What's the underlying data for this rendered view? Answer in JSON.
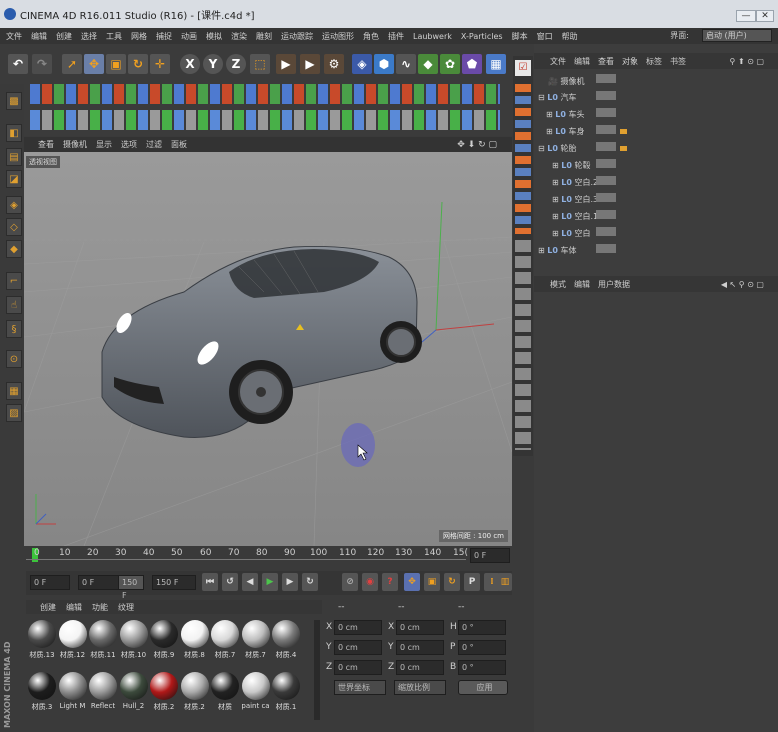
{
  "window": {
    "title": "CINEMA 4D R16.011 Studio (R16) - [课件.c4d *]",
    "minimize": "—",
    "maximize": "□",
    "close": "✕"
  },
  "menu": [
    "文件",
    "编辑",
    "创建",
    "选择",
    "工具",
    "网格",
    "捕捉",
    "动画",
    "模拟",
    "渲染",
    "雕刻",
    "运动跟踪",
    "运动图形",
    "角色",
    "插件",
    "Laubwerk",
    "X-Particles",
    "脚本",
    "窗口",
    "帮助"
  ],
  "layout": {
    "label": "界面:",
    "value": "启动 (用户)"
  },
  "toolbar": {
    "axis_x": "X",
    "axis_y": "Y",
    "axis_z": "Z"
  },
  "viewport": {
    "tabs": [
      "查看",
      "摄像机",
      "显示",
      "选项",
      "过滤",
      "面板"
    ],
    "name": "透视视图",
    "grid_label": "网格间距 : 100 cm"
  },
  "timeline": {
    "ticks": [
      "0",
      "10",
      "20",
      "30",
      "40",
      "50",
      "60",
      "70",
      "80",
      "90",
      "100",
      "110",
      "120",
      "130",
      "140",
      "15("
    ],
    "current": "0 F"
  },
  "playback": {
    "start": "0 F",
    "range_start": "0 F",
    "range_end": "150 F",
    "end": "150 F"
  },
  "materials": {
    "tabs": [
      "创建",
      "编辑",
      "功能",
      "纹理"
    ],
    "items": [
      {
        "name": "材质.13",
        "color": "#4a4a4a"
      },
      {
        "name": "材质.12",
        "color": "#f4f4f4"
      },
      {
        "name": "材质.11",
        "color": "#6a6a6a"
      },
      {
        "name": "材质.10",
        "color": "#9a9a9a"
      },
      {
        "name": "材质.9",
        "color": "#2a2a2a"
      },
      {
        "name": "材质.8",
        "color": "#f2f2f2"
      },
      {
        "name": "材质.7",
        "color": "#d8d8d8"
      },
      {
        "name": "材质.7",
        "color": "#bdbdbd"
      },
      {
        "name": "材质.4",
        "color": "#7a7a7a"
      },
      {
        "name": "材质.3",
        "color": "#1d1d1d"
      },
      {
        "name": "Light M",
        "color": "#8c8c8c"
      },
      {
        "name": "Reflect",
        "color": "#9a9a9a"
      },
      {
        "name": "Hull_2",
        "color": "#3c4a3c"
      },
      {
        "name": "材质.2",
        "color": "#b01818"
      },
      {
        "name": "材质.2",
        "color": "#aaaaaa"
      },
      {
        "name": "材质",
        "color": "#222222"
      },
      {
        "name": "paint ca",
        "color": "#c8c8c8"
      },
      {
        "name": "材质.1",
        "color": "#3a3a3a"
      }
    ]
  },
  "coords": {
    "header": [
      "--",
      "--",
      "--"
    ],
    "rows": [
      {
        "a": "X",
        "av": "0 cm",
        "b": "X",
        "bv": "0 cm",
        "c": "H",
        "cv": "0 °"
      },
      {
        "a": "Y",
        "av": "0 cm",
        "b": "Y",
        "bv": "0 cm",
        "c": "P",
        "cv": "0 °"
      },
      {
        "a": "Z",
        "av": "0 cm",
        "b": "Z",
        "bv": "0 cm",
        "c": "B",
        "cv": "0 °"
      }
    ],
    "mode1": "世界坐标",
    "mode2": "缩放比例",
    "apply": "应用"
  },
  "objects": {
    "tabs": [
      "文件",
      "编辑",
      "查看",
      "对象",
      "标签",
      "书签"
    ],
    "items": [
      "摄像机",
      "汽车",
      "车头",
      "车身",
      "轮胎",
      "轮毂",
      "空白.2",
      "空白.3",
      "空白.1",
      "空白",
      "车体"
    ]
  },
  "attributes": {
    "tabs": [
      "模式",
      "编辑",
      "用户数据"
    ]
  },
  "branding": "MAXON CINEMA 4D"
}
